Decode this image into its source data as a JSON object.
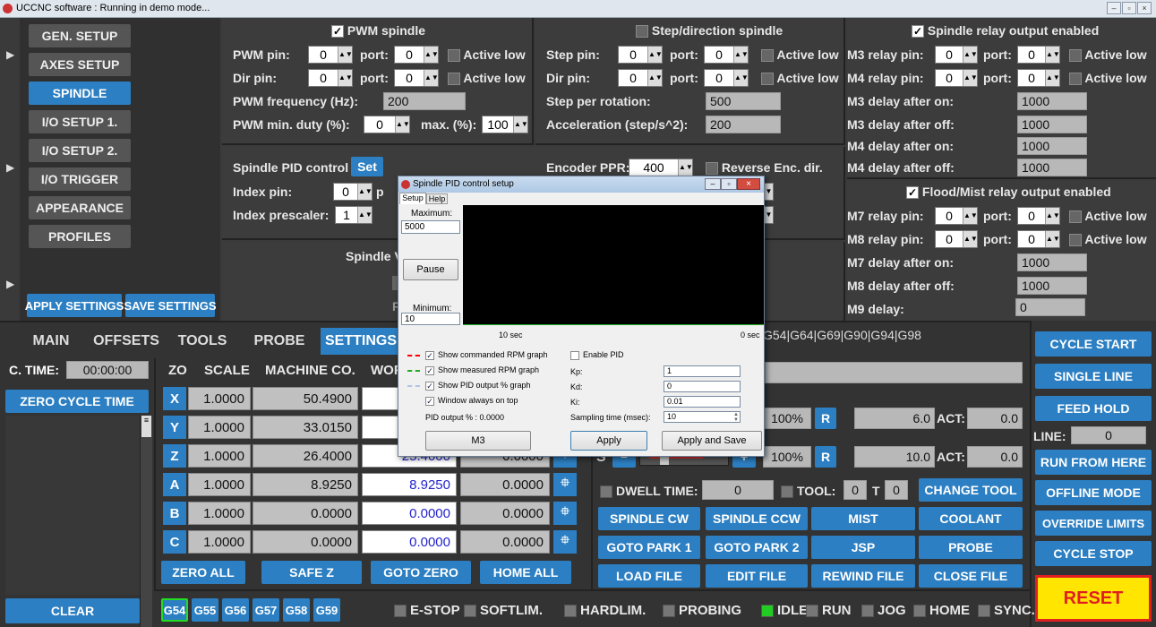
{
  "window": {
    "title": "UCCNC software : Running in demo mode..."
  },
  "left_menu": [
    "GEN. SETUP",
    "AXES SETUP",
    "SPINDLE",
    "I/O SETUP 1.",
    "I/O SETUP 2.",
    "I/O TRIGGER",
    "APPEARANCE",
    "PROFILES"
  ],
  "apply_settings": "APPLY SETTINGS",
  "save_settings": "SAVE SETTINGS",
  "pwm": {
    "title": "PWM spindle",
    "pwm_pin": "PWM pin:",
    "pwm_pin_val": "0",
    "port": "port:",
    "pwm_port_val": "0",
    "active_low": "Active low",
    "dir_pin": "Dir pin:",
    "dir_pin_val": "0",
    "dir_port_val": "0",
    "freq": "PWM frequency (Hz):",
    "freq_val": "200",
    "min_duty": "PWM min. duty (%):",
    "min_duty_val": "0",
    "max": "max. (%):",
    "max_val": "100"
  },
  "stepdir": {
    "title": "Step/direction spindle",
    "step_pin": "Step pin:",
    "step_pin_val": "0",
    "step_port_val": "0",
    "dir_pin": "Dir pin:",
    "dir_pin_val": "0",
    "dir_port_val": "0",
    "step_rot": "Step per rotation:",
    "step_rot_val": "500",
    "accel": "Acceleration (step/s^2):",
    "accel_val": "200"
  },
  "pid": {
    "label": "Spindle PID control",
    "set": "Set",
    "index_pin": "Index pin:",
    "index_pin_val": "0",
    "index_pre": "Index prescaler:",
    "index_pre_val": "1",
    "encoder": "Encoder PPR:",
    "encoder_val": "400",
    "reverse": "Reverse Enc. dir.",
    "spindle_partial": "Spindle V"
  },
  "relay": {
    "title": "Spindle relay output enabled",
    "m3_pin": "M3 relay pin:",
    "m3_pin_val": "0",
    "m3_port_val": "0",
    "m4_pin": "M4 relay pin:",
    "m4_pin_val": "0",
    "m4_port_val": "0",
    "m3_on": "M3 delay after on:",
    "m3_on_val": "1000",
    "m3_off": "M3 delay after off:",
    "m3_off_val": "1000",
    "m4_on": "M4 delay after on:",
    "m4_on_val": "1000",
    "m4_off": "M4 delay after off:",
    "m4_off_val": "1000"
  },
  "flood": {
    "title": "Flood/Mist relay output enabled",
    "m7_pin": "M7 relay pin:",
    "m7_pin_val": "0",
    "m7_port_val": "0",
    "m8_pin": "M8 relay pin:",
    "m8_pin_val": "0",
    "m8_port_val": "0",
    "m7_on": "M7 delay after on:",
    "m7_on_val": "1000",
    "m8_off": "M8 delay after off:",
    "m8_off_val": "1000",
    "m9": "M9 delay:",
    "m9_val": "0"
  },
  "tabs": [
    "MAIN",
    "OFFSETS",
    "TOOLS",
    "PROBE",
    "SETTINGS"
  ],
  "gcode_modal": "G54|G64|G69|G90|G94|G98",
  "right_buttons": [
    "CYCLE START",
    "SINGLE LINE",
    "FEED HOLD",
    "RUN FROM HERE",
    "OFFLINE MODE",
    "OVERRIDE LIMITS",
    "CYCLE STOP"
  ],
  "line_label": "LINE:",
  "line_val": "0",
  "reset": "RESET",
  "ctime_label": "C. TIME:",
  "ctime_val": "00:00:00",
  "zero_cycle": "ZERO CYCLE TIME",
  "clear": "CLEAR",
  "coord_headers": {
    "zo": "ZO",
    "scale": "SCALE",
    "machine": "MACHINE CO.",
    "work": "WOR"
  },
  "axes": [
    {
      "name": "X",
      "scale": "1.0000",
      "machine": "50.4900",
      "work": "",
      "offset": ""
    },
    {
      "name": "Y",
      "scale": "1.0000",
      "machine": "33.0150",
      "work": "",
      "offset": ""
    },
    {
      "name": "Z",
      "scale": "1.0000",
      "machine": "26.4000",
      "work": "25.4000",
      "offset": "0.0000"
    },
    {
      "name": "A",
      "scale": "1.0000",
      "machine": "8.9250",
      "work": "8.9250",
      "offset": "0.0000"
    },
    {
      "name": "B",
      "scale": "1.0000",
      "machine": "0.0000",
      "work": "0.0000",
      "offset": "0.0000"
    },
    {
      "name": "C",
      "scale": "1.0000",
      "machine": "0.0000",
      "work": "0.0000",
      "offset": "0.0000"
    }
  ],
  "bottom_axis_buttons": [
    "ZERO ALL",
    "SAFE Z",
    "GOTO ZERO",
    "HOME ALL"
  ],
  "override": {
    "f_pct": "100%",
    "s_pct": "100%",
    "r": "R",
    "f_val": "6.0",
    "s_val": "10.0",
    "act": "ACT:",
    "f_act": "0.0",
    "s_act": "0.0",
    "s_label": "S"
  },
  "dwell": "DWELL TIME:",
  "dwell_val": "0",
  "tool": "TOOL:",
  "tool_val": "0",
  "t": "T",
  "t_val": "0",
  "change_tool": "CHANGE TOOL",
  "action_buttons": [
    [
      "SPINDLE CW",
      "SPINDLE CCW",
      "MIST",
      "COOLANT"
    ],
    [
      "GOTO PARK 1",
      "GOTO PARK 2",
      "JSP",
      "PROBE"
    ],
    [
      "LOAD FILE",
      "EDIT FILE",
      "REWIND FILE",
      "CLOSE FILE"
    ]
  ],
  "wcs": [
    "G54",
    "G55",
    "G56",
    "G57",
    "G58",
    "G59"
  ],
  "status": [
    "E-STOP",
    "SOFTLIM.",
    "HARDLIM.",
    "PROBING",
    "IDLE",
    "RUN",
    "JOG",
    "HOME",
    "SYNC."
  ],
  "status_active": "IDLE",
  "dialog": {
    "title": "Spindle PID control setup",
    "tabs": [
      "Setup",
      "Help"
    ],
    "maximum": "Maximum:",
    "max_val": "5000",
    "pause": "Pause",
    "minimum": "Minimum:",
    "min_val": "10",
    "t_left": "10 sec",
    "t_right": "0 sec",
    "show_cmd": "Show commanded RPM graph",
    "show_meas": "Show measured RPM graph",
    "show_pid": "Show PID output % graph",
    "always_top": "Window always on top",
    "pid_output": "PID output % : 0.0000",
    "enable_pid": "Enable PID",
    "kp": "Kp:",
    "kp_val": "1",
    "kd": "Kd:",
    "kd_val": "0",
    "ki": "Ki:",
    "ki_val": "0.01",
    "sampling": "Sampling time (msec):",
    "sampling_val": "10",
    "m3": "M3",
    "apply": "Apply",
    "apply_save": "Apply and Save",
    "colors": {
      "commanded": "#ff0000",
      "measured": "#22aa22",
      "pid": "#6699ff"
    }
  }
}
